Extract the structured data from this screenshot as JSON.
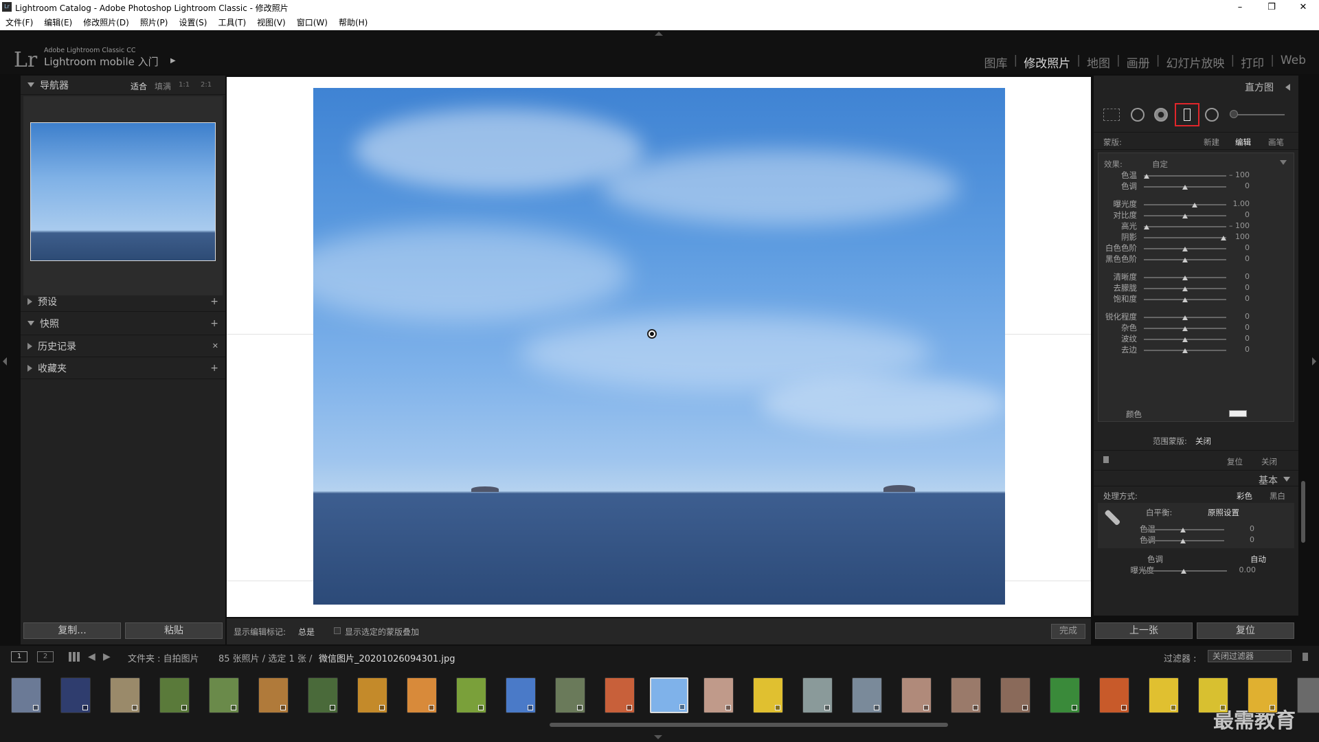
{
  "window": {
    "title": "Lightroom Catalog - Adobe Photoshop Lightroom Classic - 修改照片",
    "icon_label": "Lr",
    "controls": {
      "minimize": "–",
      "maximize": "❐",
      "close": "✕"
    }
  },
  "menu": [
    "文件(F)",
    "编辑(E)",
    "修改照片(D)",
    "照片(P)",
    "设置(S)",
    "工具(T)",
    "视图(V)",
    "窗口(W)",
    "帮助(H)"
  ],
  "header": {
    "product": "Adobe Lightroom Classic CC",
    "mobile": "Lightroom mobile 入门",
    "arrow": "▶",
    "logo": "Lr"
  },
  "modules": [
    {
      "label": "图库"
    },
    {
      "label": "修改照片",
      "active": true
    },
    {
      "label": "地图"
    },
    {
      "label": "画册"
    },
    {
      "label": "幻灯片放映"
    },
    {
      "label": "打印"
    },
    {
      "label": "Web"
    }
  ],
  "navigator": {
    "title": "导航器",
    "zoom": [
      "适合",
      "填满",
      "1:1",
      "2:1"
    ]
  },
  "left_panels": [
    {
      "label": "预设",
      "action": "+"
    },
    {
      "label": "快照",
      "action": "+"
    },
    {
      "label": "历史记录",
      "action": "✕"
    },
    {
      "label": "收藏夹",
      "action": "+"
    }
  ],
  "left_buttons": {
    "copy": "复制...",
    "paste": "粘贴"
  },
  "toolbar": {
    "show_marks_label": "显示编辑标记:",
    "show_marks_value": "总是",
    "overlay_label": "显示选定的蒙版叠加",
    "done": "完成"
  },
  "right": {
    "histogram": "直方图",
    "mask_label": "蒙版:",
    "mask_new": "新建",
    "mask_edit": "编辑",
    "mask_brush": "画笔",
    "effect_label": "效果:",
    "effect_value": "自定",
    "adjust": [
      {
        "label": "色温",
        "value": "– 100",
        "pos": 0.03
      },
      {
        "label": "色调",
        "value": "0",
        "pos": 0.5
      },
      {
        "label": "曝光度",
        "value": "1.00",
        "pos": 0.62
      },
      {
        "label": "对比度",
        "value": "0",
        "pos": 0.5
      },
      {
        "label": "高光",
        "value": "– 100",
        "pos": 0.03
      },
      {
        "label": "阴影",
        "value": "100",
        "pos": 0.97
      },
      {
        "label": "白色色阶",
        "value": "0",
        "pos": 0.5
      },
      {
        "label": "黑色色阶",
        "value": "0",
        "pos": 0.5
      },
      {
        "label": "清晰度",
        "value": "0",
        "pos": 0.5
      },
      {
        "label": "去朦胧",
        "value": "0",
        "pos": 0.5
      },
      {
        "label": "饱和度",
        "value": "0",
        "pos": 0.5
      },
      {
        "label": "锐化程度",
        "value": "0",
        "pos": 0.5
      },
      {
        "label": "杂色",
        "value": "0",
        "pos": 0.5
      },
      {
        "label": "波纹",
        "value": "0",
        "pos": 0.5
      },
      {
        "label": "去边",
        "value": "0",
        "pos": 0.5
      }
    ],
    "color_label": "颜色",
    "range_mask_label": "范围蒙版:",
    "range_mask_value": "关闭",
    "reset": "复位",
    "close": "关闭",
    "basic": "基本",
    "treatment_label": "处理方式:",
    "color": "彩色",
    "bw": "黑白",
    "wb_label": "白平衡:",
    "wb_value": "原照设置",
    "wb_sliders": [
      {
        "label": "色温",
        "value": "0",
        "pos": 0.5
      },
      {
        "label": "色调",
        "value": "0",
        "pos": 0.5
      }
    ],
    "tone_label": "色调",
    "auto": "自动",
    "exposure": {
      "label": "曝光度",
      "value": "0.00",
      "pos": 0.5
    },
    "prev": "上一张",
    "reset_btn": "复位"
  },
  "filmstrip_bar": {
    "pages": [
      "1",
      "2"
    ],
    "path": "文件夹 : 自拍图片",
    "count": "85 张照片 / 选定 1 张 /",
    "file": "微信图片_20201026094301.jpg",
    "filter_label": "过滤器 :",
    "filter_value": "关闭过滤器"
  },
  "watermark": "最需教育",
  "colors": {
    "accent_red": "#e0262b",
    "sky": "#4d8fd6",
    "sea": "#2f4f7c"
  }
}
